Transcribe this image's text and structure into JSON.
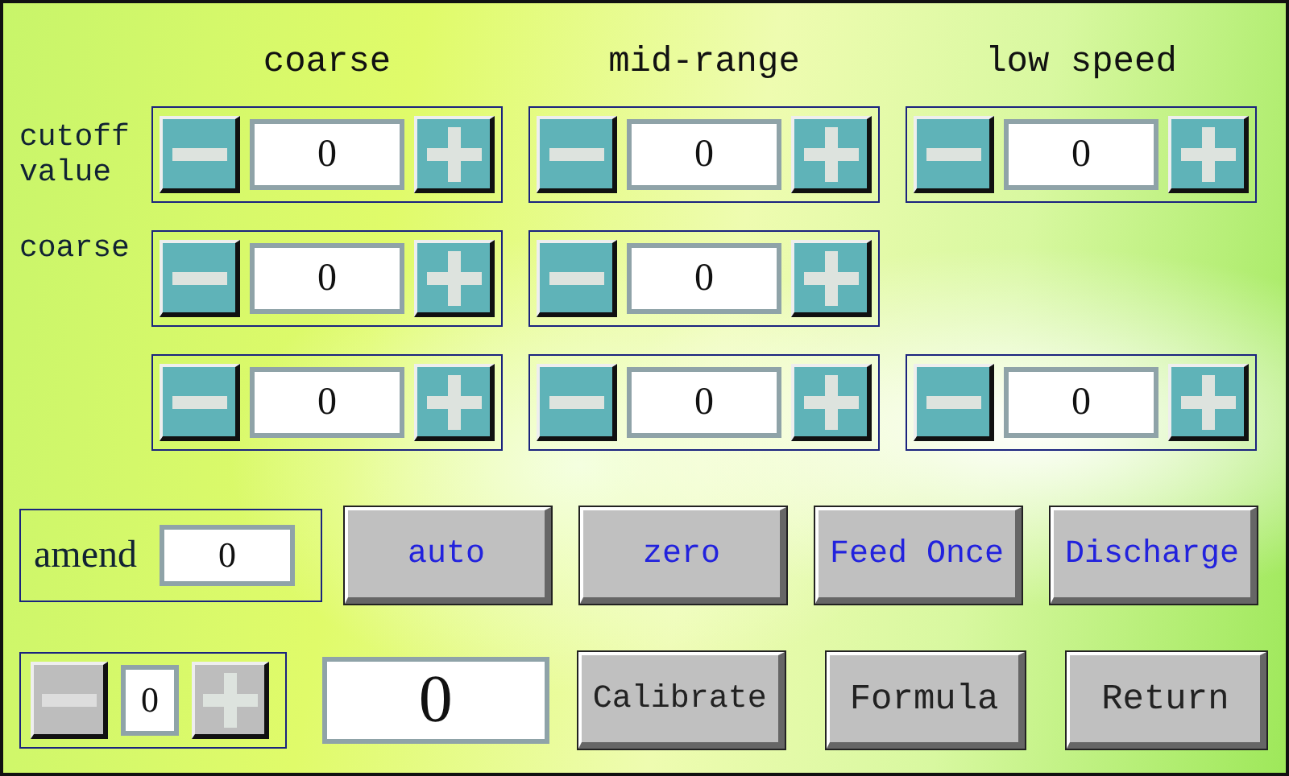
{
  "columns": [
    "coarse",
    "mid-range",
    "low speed"
  ],
  "rows": [
    {
      "label": "cutoff value",
      "cells": [
        {
          "value": "0"
        },
        {
          "value": "0"
        },
        {
          "value": "0"
        }
      ]
    },
    {
      "label": "coarse",
      "cells": [
        {
          "value": "0"
        },
        {
          "value": "0"
        }
      ]
    },
    {
      "cells": [
        {
          "value": "0"
        },
        {
          "value": "0"
        },
        {
          "value": "0"
        }
      ]
    }
  ],
  "amend": {
    "label": "amend",
    "value": "0"
  },
  "action_buttons": [
    "auto",
    "zero",
    "Feed Once",
    "Discharge"
  ],
  "small_stepper": {
    "value": "0",
    "disabled": true
  },
  "display": {
    "value": "0"
  },
  "nav_buttons": [
    "Calibrate",
    "Formula",
    "Return"
  ]
}
